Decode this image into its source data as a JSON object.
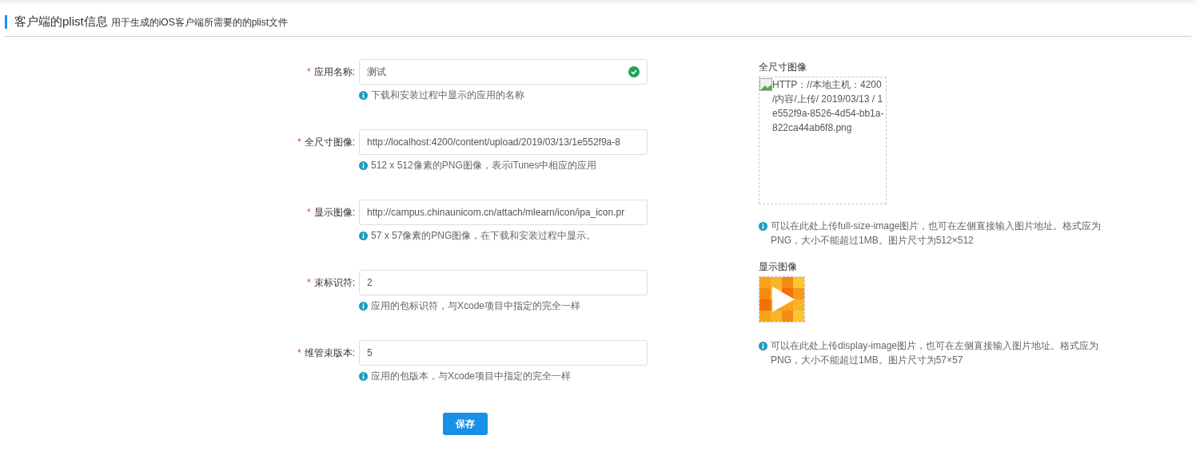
{
  "header": {
    "title": "客户端的plist信息",
    "subtitle": "用于生成的iOS客户端所需要的的plist文件"
  },
  "fields": [
    {
      "label": "应用名称:",
      "required_mark": "*",
      "value": "测试",
      "valid": true,
      "help": "下载和安装过程中显示的应用的名称"
    },
    {
      "label": "全尺寸图像:",
      "required_mark": "*",
      "value": "http://localhost:4200/content/upload/2019/03/13/1e552f9a-8",
      "valid": false,
      "help": "512 x 512像素的PNG图像，表示iTunes中相应的应用"
    },
    {
      "label": "显示图像:",
      "required_mark": "*",
      "value": "http://campus.chinaunicom.cn/attach/mlearn/icon/ipa_icon.pr",
      "valid": false,
      "help": "57 x 57像素的PNG图像，在下载和安装过程中显示。"
    },
    {
      "label": "束标识符:",
      "required_mark": "*",
      "value": "2",
      "valid": false,
      "help": "应用的包标识符，与Xcode项目中指定的完全一样"
    },
    {
      "label": "维管束版本:",
      "required_mark": "*",
      "value": "5",
      "valid": false,
      "help": "应用的包版本，与Xcode项目中指定的完全一样"
    }
  ],
  "save_button": "保存",
  "full_size_image": {
    "label": "全尺寸图像",
    "alt_text": "HTTP：//本地主机：4200 /内容/上传/ 2019/03/13 / 1e552f9a-8526-4d54-bb1a-822ca44ab6f8.png",
    "help": "可以在此处上传full-size-image图片，也可在左侧直接输入图片地址。格式应为PNG，大小不能超过1MB。图片尺寸为512×512"
  },
  "display_image": {
    "label": "显示图像",
    "kind": "picture",
    "help": "可以在此处上传display-image图片，也可在左侧直接输入图片地址。格式应为PNG，大小不能超过1MB。图片尺寸为57×57"
  }
}
